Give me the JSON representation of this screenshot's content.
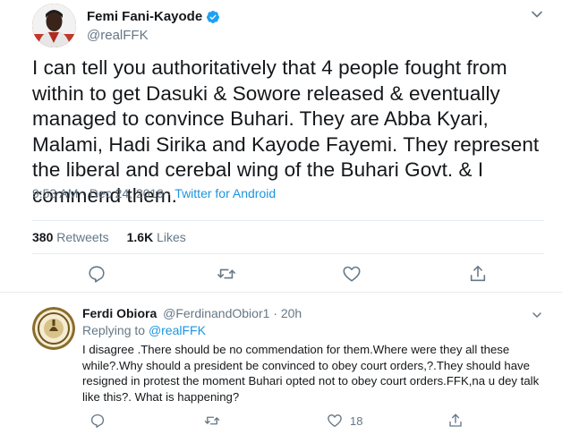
{
  "tweet": {
    "author_name": "Femi Fani-Kayode",
    "author_handle": "@realFFK",
    "text": "I can tell you authoritatively that 4 people fought from within to get Dasuki & Sowore released & eventually managed to convince Buhari. They are Abba Kyari, Malami, Hadi Sirika and Kayode Fayemi. They represent the liberal and cerebal wing of the Buhari Govt. & I commend them.",
    "timestamp": "9:53 AM · Dec 24, 2019",
    "separator": " · ",
    "source": "Twitter for Android",
    "retweets_count": "380",
    "retweets_label": "Retweets",
    "likes_count": "1.6K",
    "likes_label": "Likes"
  },
  "reply": {
    "author_name": "Ferdi Obiora",
    "author_handle": "@FerdinandObior1",
    "time": "· 20h",
    "replying_prefix": "Replying to",
    "replying_to": "@realFFK",
    "text": "I disagree .There should be no commendation for them.Where were they all these while?.Why should a president be convinced to obey court orders,?.They should have resigned in protest the moment Buhari opted not to obey court orders.FFK,na u dey talk like this?. What is happening?",
    "likes_count": "18"
  },
  "icons": {
    "verified": "verified-badge-icon",
    "more": "chevron-down-icon",
    "reply": "reply-icon",
    "retweet": "retweet-icon",
    "like": "heart-icon",
    "share": "share-icon"
  },
  "colors": {
    "accent": "#1b95e0",
    "secondary_text": "#657786",
    "primary_text": "#14171a",
    "border": "#e6ecf0"
  }
}
